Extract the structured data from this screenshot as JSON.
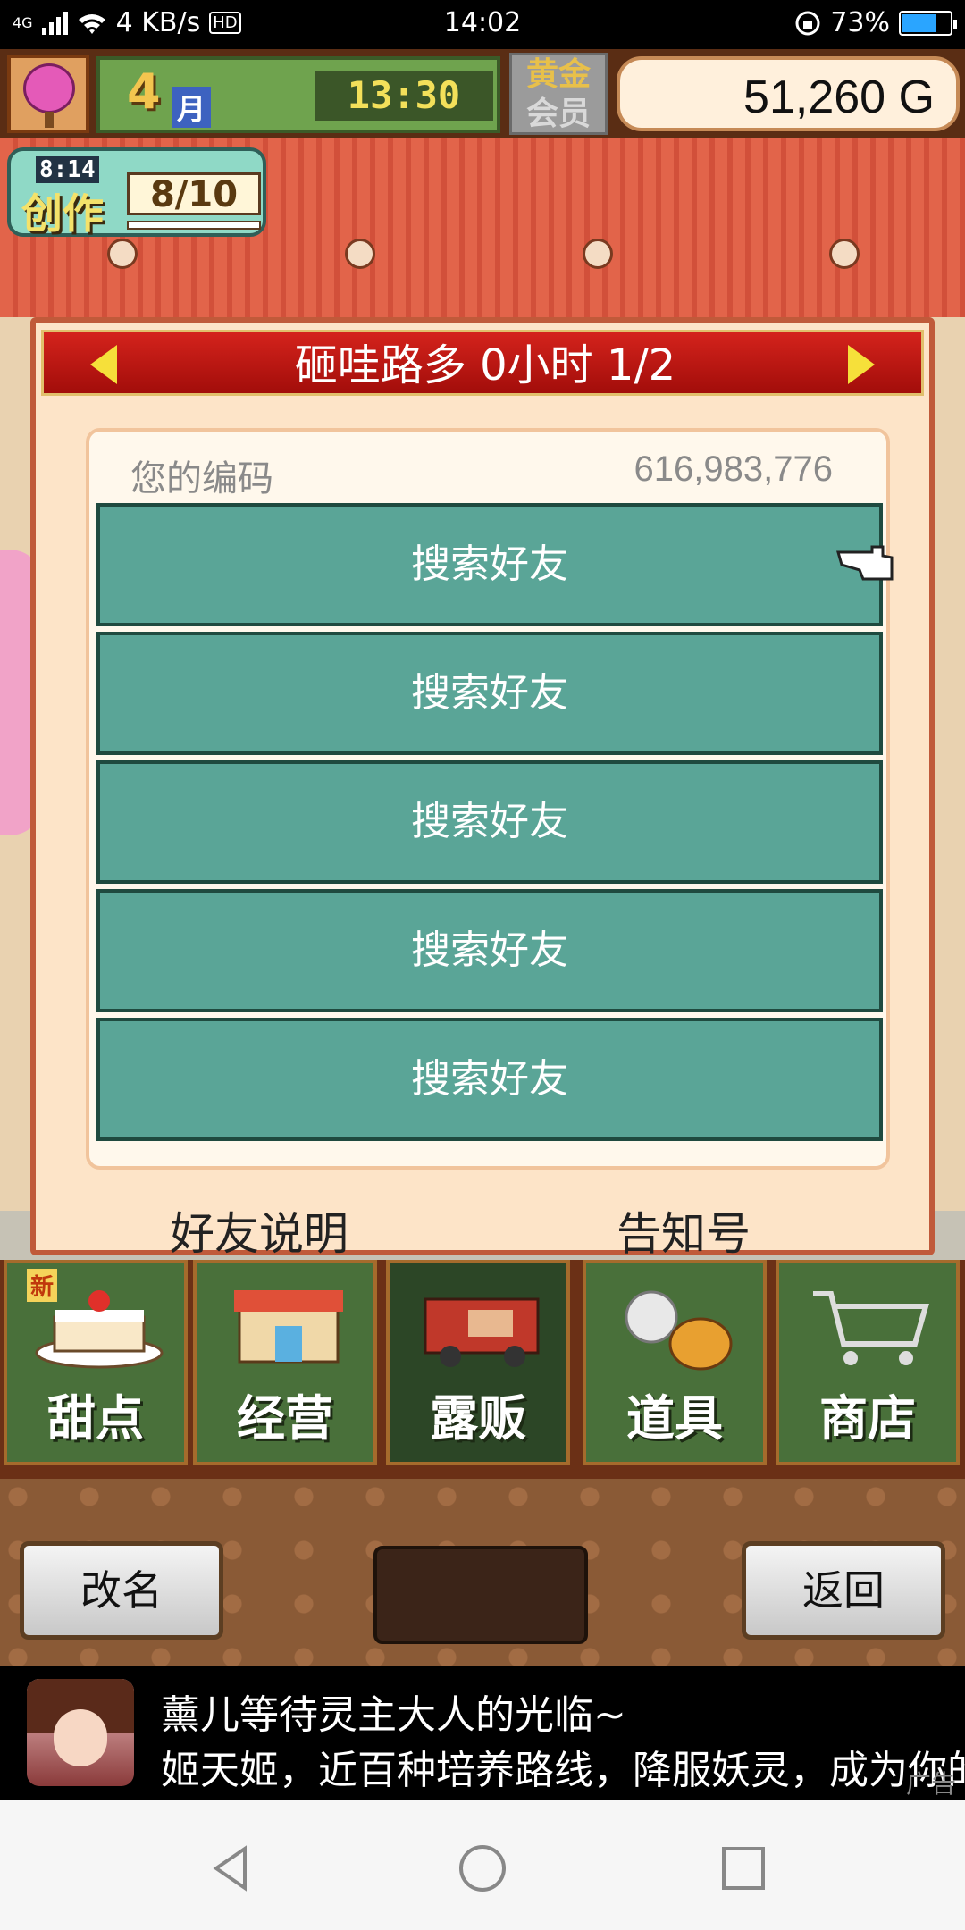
{
  "status_bar": {
    "network": "4G",
    "speed": "4 KB/s",
    "hd": "HD",
    "time": "14:02",
    "battery": "73%",
    "battery_level": 0.73
  },
  "hud": {
    "month_number": "4",
    "month_label": "月",
    "clock": "13:30",
    "gold_member_top": "黄金",
    "gold_member_bottom": "会员",
    "money": "51,260",
    "money_unit": "G",
    "create_time": "8:14",
    "create_label": "创作",
    "create_count": "8/10"
  },
  "dialog": {
    "title": "砸哇路多  0小时 1/2",
    "code_label": "您的编码",
    "code_value": "616,983,776",
    "friend_rows": [
      "搜索好友",
      "搜索好友",
      "搜索好友",
      "搜索好友",
      "搜索好友"
    ],
    "friends_desc": "好友说明",
    "notice": "告知号"
  },
  "tabs": [
    {
      "label": "甜点",
      "icon": "cake-icon",
      "badge": "新"
    },
    {
      "label": "经营",
      "icon": "shop-icon"
    },
    {
      "label": "露贩",
      "icon": "food-truck-icon"
    },
    {
      "label": "道具",
      "icon": "item-bag-icon"
    },
    {
      "label": "商店",
      "icon": "cart-icon"
    }
  ],
  "menu": {
    "rename": "改名",
    "return": "返回"
  },
  "ad": {
    "title": "薰儿等待灵主大人的光临~",
    "text": "姬天姬，近百种培养路线，降服妖灵，成为你的得",
    "badge": "广告"
  },
  "colors": {
    "friend_row": "#5aa597",
    "dialog_header": "#c0180f",
    "panel_bg": "#fde4c8"
  }
}
